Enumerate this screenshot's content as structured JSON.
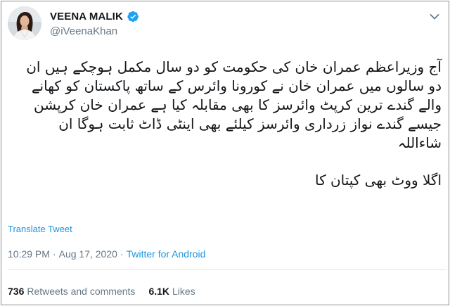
{
  "author": {
    "name": "VEENA MALIK",
    "handle": "@iVeenaKhan",
    "verified": true
  },
  "tweet": {
    "paragraph_1": "آج وزیراعظم عمران خان کی حکومت کو دو سال مکمل ہوچکے ہیں ان دو سالوں میں عمران خان نے کورونا وائرس کے ساتھ پاکستان کو کھانے والے گندے ترین کرپٹ وائرسز کا بھی مقابلہ کیا ہے عمران خان کرپشن جیسے گندے نواز زرداری وائرسز کیلئے بھی اینٹی ڈاٹ ثابت ہوگا ان شاءاللہ",
    "paragraph_2": "اگلا ووٹ بھی کپتان کا",
    "translate_label": "Translate Tweet"
  },
  "meta": {
    "time": "10:29 PM",
    "separator": "·",
    "date": "Aug 17, 2020",
    "separator2": "·",
    "source": "Twitter for Android"
  },
  "stats": {
    "retweets_count": "736",
    "retweets_label": "Retweets and comments",
    "likes_count": "6.1K",
    "likes_label": "Likes"
  },
  "colors": {
    "link": "#1b95e0",
    "secondary_text": "#657786",
    "verified_badge": "#1da1f2"
  },
  "icons": {
    "verified": "verified-badge-icon",
    "more": "chevron-down-icon"
  }
}
